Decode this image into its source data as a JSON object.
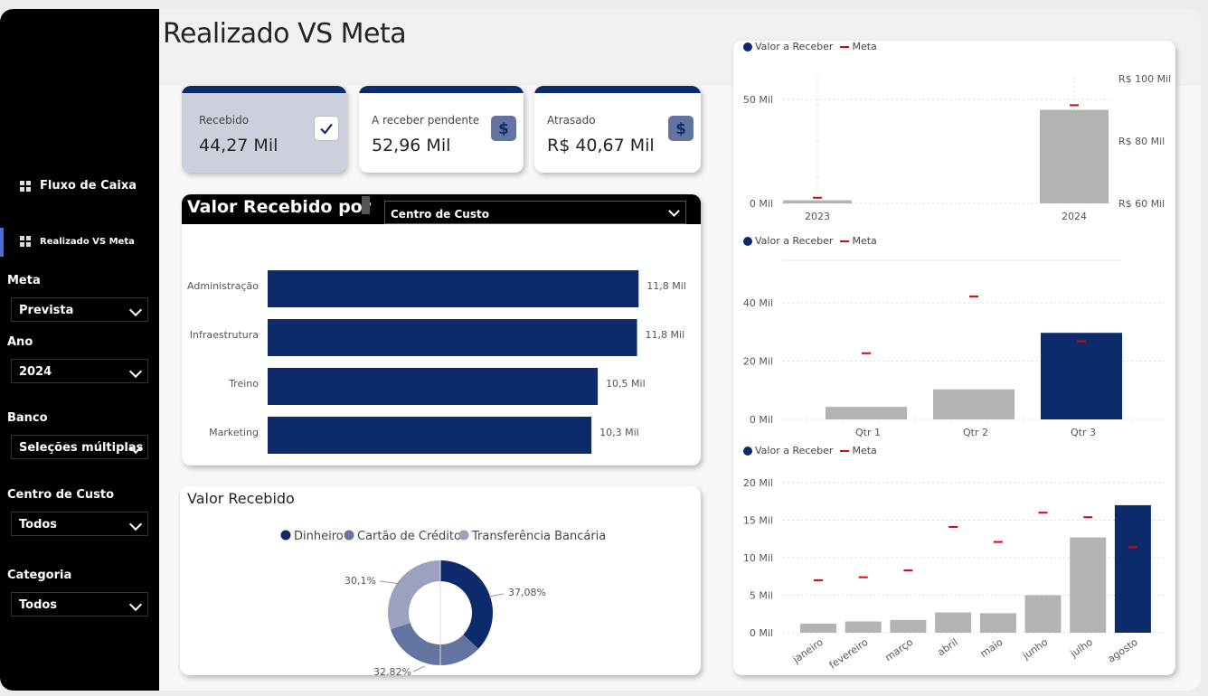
{
  "page": {
    "title": "Realizado VS Meta"
  },
  "nav": {
    "items": [
      {
        "label": "Fluxo de Caixa"
      },
      {
        "label": "Realizado VS Meta"
      }
    ]
  },
  "filters": {
    "meta": {
      "label": "Meta",
      "value": "Prevista"
    },
    "ano": {
      "label": "Ano",
      "value": "2024"
    },
    "banco": {
      "label": "Banco",
      "value": "Seleções múltiplas"
    },
    "centro": {
      "label": "Centro de Custo",
      "value": "Todos"
    },
    "categoria": {
      "label": "Categoria",
      "value": "Todos"
    }
  },
  "cards": [
    {
      "label": "Recebido",
      "value": "44,27 Mil",
      "icon": "check-icon"
    },
    {
      "label": "A receber pendente",
      "value": "52,96 Mil",
      "icon": "dollar-icon"
    },
    {
      "label": "Atrasado",
      "value": "R$ 40,67 Mil",
      "icon": "dollar-icon"
    }
  ],
  "colors": {
    "navy": "#0d2a6b",
    "grey_bar": "#b3b3b3",
    "meta_red": "#e0000f",
    "card_selected": "#ccd0dc"
  },
  "bar_panel": {
    "title": "Valor Recebido por",
    "selector_value": "Centro de Custo"
  },
  "donut_panel": {
    "title": "Valor Recebido"
  },
  "right_legend": {
    "series1": "Valor a Receber",
    "series2": "Meta"
  },
  "chart_data": [
    {
      "type": "bar",
      "orientation": "horizontal",
      "categories": [
        "Administração",
        "Infraestrutura",
        "Treino",
        "Marketing"
      ],
      "values": [
        11.8,
        11.75,
        10.5,
        10.3
      ],
      "data_labels": [
        "11,8 Mil",
        "11,8 Mil",
        "10,5 Mil",
        "10,3 Mil"
      ],
      "xlim": [
        0,
        13
      ]
    },
    {
      "type": "pie",
      "donut": true,
      "legend": [
        "Dinheiro",
        "Cartão de Crédito",
        "Transferência Bancária"
      ],
      "values": [
        37.08,
        32.82,
        30.1
      ],
      "data_labels": [
        "37,08%",
        "32,82%",
        "30,1%"
      ],
      "colors": [
        "#0d2a6b",
        "#6474a0",
        "#9aa2c0"
      ]
    },
    {
      "type": "bar",
      "title": "",
      "categories": [
        "2023",
        "2024"
      ],
      "series": [
        {
          "name": "Valor a Receber",
          "values": [
            1.5,
            45
          ]
        },
        {
          "name": "Meta",
          "values": [
            61.8,
            91.5
          ],
          "axis": "secondary"
        }
      ],
      "y_ticks": [
        "0 Mil",
        "50 Mil"
      ],
      "ylim": [
        0,
        50
      ],
      "y2_ticks": [
        "R$ 60 Mil",
        "R$ 80 Mil",
        "R$ 100 Mil"
      ],
      "y2lim": [
        60,
        100
      ]
    },
    {
      "type": "bar",
      "categories": [
        "Qtr 1",
        "Qtr 2",
        "Qtr 3"
      ],
      "series": [
        {
          "name": "Valor a Receber",
          "values": [
            4.3,
            10.3,
            29.7
          ]
        },
        {
          "name": "Meta",
          "values": [
            22.7,
            42.2,
            26.8
          ]
        }
      ],
      "y_ticks": [
        "0 Mil",
        "20 Mil",
        "40 Mil"
      ],
      "ylim": [
        0,
        40
      ]
    },
    {
      "type": "bar",
      "categories": [
        "janeiro",
        "fevereiro",
        "março",
        "abril",
        "maio",
        "junho",
        "julho",
        "agosto"
      ],
      "series": [
        {
          "name": "Valor a Receber",
          "values": [
            1.2,
            1.5,
            1.7,
            2.7,
            2.6,
            5.0,
            12.7,
            17.0
          ]
        },
        {
          "name": "Meta",
          "values": [
            7.0,
            7.4,
            8.3,
            14.1,
            12.1,
            16.0,
            15.4,
            11.4
          ]
        }
      ],
      "y_ticks": [
        "0 Mil",
        "5 Mil",
        "10 Mil",
        "15 Mil",
        "20 Mil"
      ],
      "ylim": [
        0,
        20
      ]
    }
  ]
}
